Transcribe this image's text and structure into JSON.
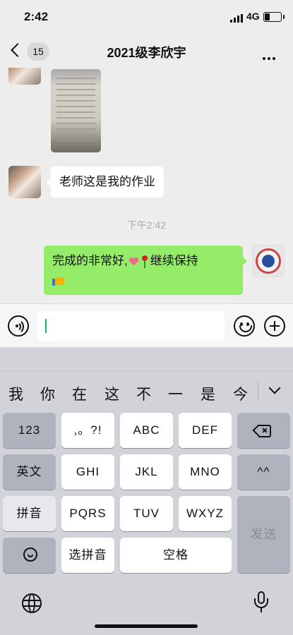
{
  "status": {
    "time": "2:42",
    "network": "4G",
    "battery_level": 0.35
  },
  "header": {
    "back_count": "15",
    "title": "2021级李欣宇"
  },
  "messages": {
    "received_text": "老师这是我的作业",
    "timestamp": "下午2:42",
    "sent_text_a": "完成的非常好,",
    "sent_text_b": "继续保持"
  },
  "candidates": [
    "我",
    "你",
    "在",
    "这",
    "不",
    "一",
    "是",
    "今天"
  ],
  "keyboard": {
    "row1": [
      "123",
      ",。?!",
      "ABC",
      "DEF"
    ],
    "row2": [
      "英文",
      "GHI",
      "JKL",
      "MNO",
      "^^"
    ],
    "row3": [
      "拼音",
      "PQRS",
      "TUV",
      "WXYZ"
    ],
    "select_pinyin": "选拼音",
    "space": "空格",
    "send": "发送"
  }
}
